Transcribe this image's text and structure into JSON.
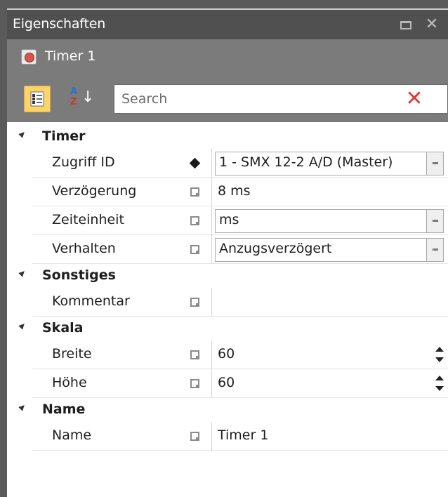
{
  "panel": {
    "title": "Eigenschaften",
    "object_name": "Timer 1"
  },
  "toolbar": {
    "categorized_icon": "categorized-view-icon",
    "alphabetical_icon": "sort-az-icon",
    "alpha_a": "A",
    "alpha_z": "Z",
    "alpha_arrow": "↓",
    "search_placeholder": "Search",
    "clear_glyph": "✕"
  },
  "titlebar": {
    "close_glyph": "✕"
  },
  "categories": [
    {
      "label": "Timer",
      "properties": [
        {
          "name": "Zugriff ID",
          "mark": "diamond",
          "value": "1 - SMX 12-2 A/D (Master)",
          "editor": "combo"
        },
        {
          "name": "Verzögerung",
          "mark": "square",
          "value": "8 ms",
          "editor": "text"
        },
        {
          "name": "Zeiteinheit",
          "mark": "square",
          "value": "ms",
          "editor": "combo"
        },
        {
          "name": "Verhalten",
          "mark": "square",
          "value": "Anzugsverzögert",
          "editor": "combo"
        }
      ]
    },
    {
      "label": "Sonstiges",
      "properties": [
        {
          "name": "Kommentar",
          "mark": "square",
          "value": "",
          "editor": "text"
        }
      ]
    },
    {
      "label": "Skala",
      "properties": [
        {
          "name": "Breite",
          "mark": "square",
          "value": "60",
          "editor": "spinner"
        },
        {
          "name": "Höhe",
          "mark": "square",
          "value": "60",
          "editor": "spinner"
        }
      ]
    },
    {
      "label": "Name",
      "properties": [
        {
          "name": "Name",
          "mark": "square",
          "value": "Timer 1",
          "editor": "text"
        }
      ]
    }
  ],
  "colors": {
    "titlebar_bg": "#505050",
    "header_bg": "#7b7b7b",
    "active_button": "#fcd469",
    "clear_red": "#e03b3b"
  }
}
